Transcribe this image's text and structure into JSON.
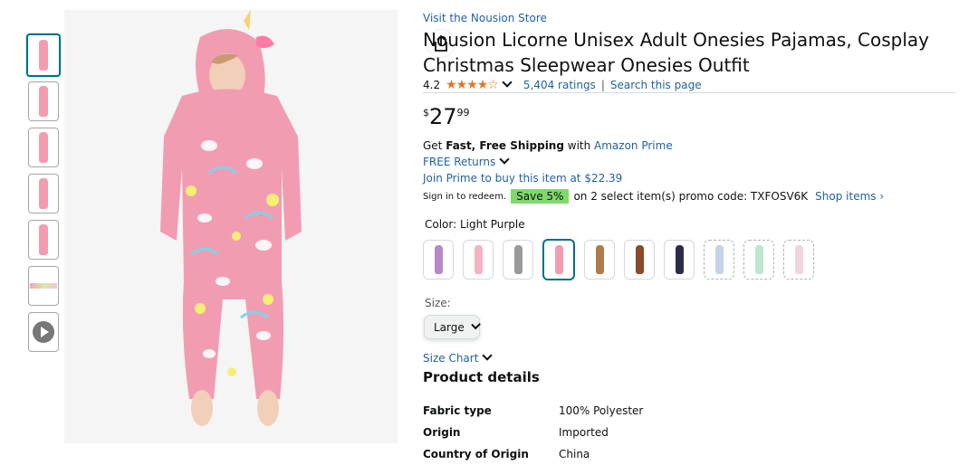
{
  "store_link": "Visit the Nousion Store",
  "title": "Nousion Licorne Unisex Adult Onesies Pajamas, Cosplay Christmas Sleepwear Onesies Outfit",
  "rating": {
    "value": "4.2",
    "stars_filled": 4.2,
    "count": "5,404 ratings",
    "search": "Search this page",
    "separator": "|"
  },
  "price": {
    "currency": "$",
    "whole": "27",
    "fraction": "99"
  },
  "shipping": {
    "prefix": "Get ",
    "bold": "Fast, Free Shipping",
    "middle": " with ",
    "prime_link": "Amazon Prime"
  },
  "free_returns": "FREE Returns",
  "join_prime": "Join Prime to buy this item at $22.39",
  "promo": {
    "signin": "Sign in to redeem.",
    "badge": "Save 5%",
    "text": "on 2 select item(s) promo code: TXFOSV6K",
    "link": "Shop items ›"
  },
  "color": {
    "label": "Color: ",
    "selected": "Light Purple",
    "swatches": [
      "purple-stripe",
      "pink-unicorn-light",
      "grey-panda",
      "pink-unicorn",
      "brown-giraffe",
      "brown-bear",
      "navy-print",
      "blue-light",
      "green-light",
      "pink-light"
    ]
  },
  "size": {
    "label": "Size:",
    "selected": "Large"
  },
  "size_chart": "Size Chart",
  "product_details": {
    "title": "Product details",
    "rows": [
      {
        "key": "Fabric type",
        "value": "100% Polyester"
      },
      {
        "key": "Origin",
        "value": "Imported"
      },
      {
        "key": "Country of Origin",
        "value": "China"
      }
    ]
  },
  "colors": {
    "link": "#2162a1",
    "accent_teal": "#007185",
    "star": "#de7921",
    "save_badge": "#7fda69",
    "onesie_pink": "#f29cb2"
  }
}
